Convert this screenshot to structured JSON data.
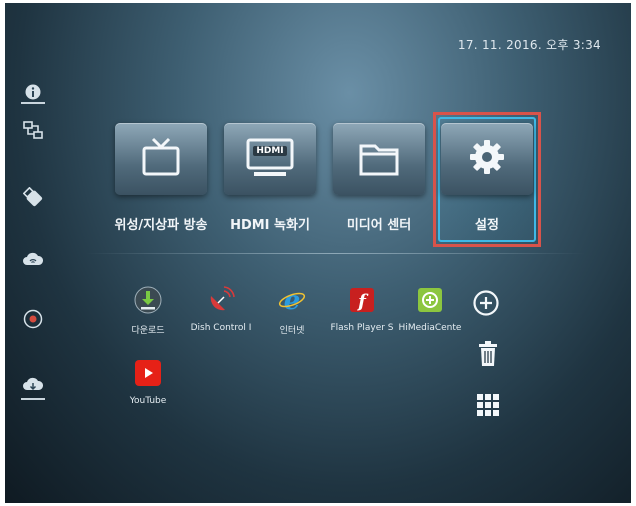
{
  "status": {
    "datetime": "17. 11. 2016. 오후 3:34"
  },
  "sidebar": {
    "items": [
      {
        "icon": "info-icon"
      },
      {
        "icon": "network-icon"
      },
      {
        "icon": "usb-icon"
      },
      {
        "icon": "cloud-wifi-icon"
      },
      {
        "icon": "record-icon"
      },
      {
        "icon": "cloud-download-icon"
      }
    ]
  },
  "main_tiles": [
    {
      "label": "위성/지상파 방송",
      "icon": "tv-icon"
    },
    {
      "label": "HDMI 녹화기",
      "icon": "hdmi-monitor-icon",
      "badge": "HDMI"
    },
    {
      "label": "미디어 센터",
      "icon": "folder-icon"
    },
    {
      "label": "설정",
      "icon": "gear-icon",
      "selected": true
    }
  ],
  "apps": [
    {
      "label": "다운로드",
      "icon": "download-icon"
    },
    {
      "label": "Dish Control I",
      "icon": "satellite-dish-icon"
    },
    {
      "label": "인터넷",
      "icon": "internet-explorer-icon"
    },
    {
      "label": "Flash Player S",
      "icon": "flash-player-icon"
    },
    {
      "label": "HiMediaCente",
      "icon": "himedia-center-icon"
    },
    {
      "label": "YouTube",
      "icon": "youtube-icon"
    }
  ],
  "tools": [
    {
      "icon": "add-icon"
    },
    {
      "icon": "trash-icon"
    },
    {
      "icon": "app-grid-icon"
    }
  ],
  "colors": {
    "selection_frame": "#d9534a",
    "focus_ring": "#3fb8e6"
  }
}
